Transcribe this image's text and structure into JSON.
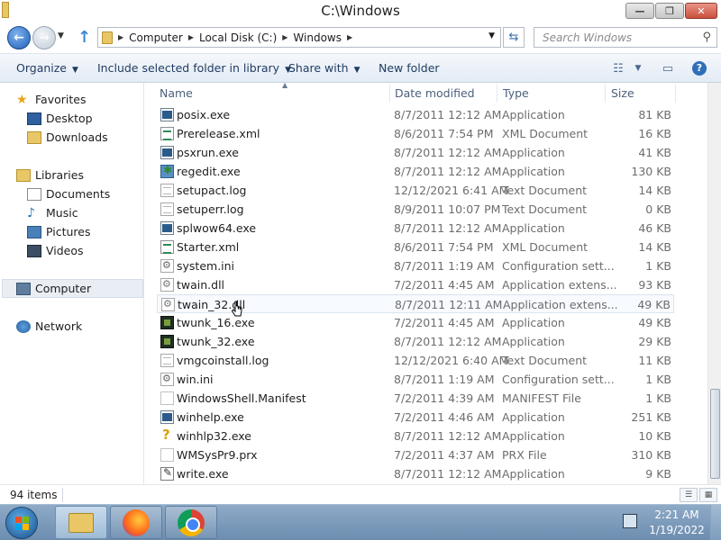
{
  "window": {
    "title": "C:\\Windows",
    "buttons": {
      "minimize": "—",
      "maximize": "❐",
      "close": "✕"
    }
  },
  "address": {
    "crumbs": [
      "Computer",
      "Local Disk (C:)",
      "Windows"
    ],
    "search_placeholder": "Search Windows"
  },
  "toolbar": {
    "organize": "Organize",
    "include": "Include selected folder in library",
    "share": "Share with",
    "new_folder": "New folder"
  },
  "nav": {
    "favorites": "Favorites",
    "desktop": "Desktop",
    "downloads": "Downloads",
    "libraries": "Libraries",
    "documents": "Documents",
    "music": "Music",
    "pictures": "Pictures",
    "videos": "Videos",
    "computer": "Computer",
    "network": "Network"
  },
  "columns": {
    "name": "Name",
    "date": "Date modified",
    "type": "Type",
    "size": "Size"
  },
  "files": [
    {
      "name": "posix.exe",
      "date": "8/7/2011 12:12 AM",
      "type": "Application",
      "size": "81 KB",
      "icon": "app"
    },
    {
      "name": "Prerelease.xml",
      "date": "8/6/2011 7:54 PM",
      "type": "XML Document",
      "size": "16 KB",
      "icon": "xml"
    },
    {
      "name": "psxrun.exe",
      "date": "8/7/2011 12:12 AM",
      "type": "Application",
      "size": "41 KB",
      "icon": "app"
    },
    {
      "name": "regedit.exe",
      "date": "8/7/2011 12:12 AM",
      "type": "Application",
      "size": "130 KB",
      "icon": "reg"
    },
    {
      "name": "setupact.log",
      "date": "12/12/2021 6:41 AM",
      "type": "Text Document",
      "size": "14 KB",
      "icon": "txt"
    },
    {
      "name": "setuperr.log",
      "date": "8/9/2011 10:07 PM",
      "type": "Text Document",
      "size": "0 KB",
      "icon": "txt"
    },
    {
      "name": "splwow64.exe",
      "date": "8/7/2011 12:12 AM",
      "type": "Application",
      "size": "46 KB",
      "icon": "app"
    },
    {
      "name": "Starter.xml",
      "date": "8/6/2011 7:54 PM",
      "type": "XML Document",
      "size": "14 KB",
      "icon": "xml"
    },
    {
      "name": "system.ini",
      "date": "8/7/2011 1:19 AM",
      "type": "Configuration sett...",
      "size": "1 KB",
      "icon": "cfg"
    },
    {
      "name": "twain.dll",
      "date": "7/2/2011 4:45 AM",
      "type": "Application extens...",
      "size": "93 KB",
      "icon": "dll"
    },
    {
      "name": "twain_32.dll",
      "date": "8/7/2011 12:11 AM",
      "type": "Application extens...",
      "size": "49 KB",
      "icon": "dll"
    },
    {
      "name": "twunk_16.exe",
      "date": "7/2/2011 4:45 AM",
      "type": "Application",
      "size": "49 KB",
      "icon": "twunk"
    },
    {
      "name": "twunk_32.exe",
      "date": "8/7/2011 12:12 AM",
      "type": "Application",
      "size": "29 KB",
      "icon": "twunk"
    },
    {
      "name": "vmgcoinstall.log",
      "date": "12/12/2021 6:40 AM",
      "type": "Text Document",
      "size": "11 KB",
      "icon": "txt"
    },
    {
      "name": "win.ini",
      "date": "8/7/2011 1:19 AM",
      "type": "Configuration sett...",
      "size": "1 KB",
      "icon": "cfg"
    },
    {
      "name": "WindowsShell.Manifest",
      "date": "7/2/2011 4:39 AM",
      "type": "MANIFEST File",
      "size": "1 KB",
      "icon": "blank"
    },
    {
      "name": "winhelp.exe",
      "date": "7/2/2011 4:46 AM",
      "type": "Application",
      "size": "251 KB",
      "icon": "app"
    },
    {
      "name": "winhlp32.exe",
      "date": "8/7/2011 12:12 AM",
      "type": "Application",
      "size": "10 KB",
      "icon": "help"
    },
    {
      "name": "WMSysPr9.prx",
      "date": "7/2/2011 4:37 AM",
      "type": "PRX File",
      "size": "310 KB",
      "icon": "blank"
    },
    {
      "name": "write.exe",
      "date": "8/7/2011 12:12 AM",
      "type": "Application",
      "size": "9 KB",
      "icon": "write"
    }
  ],
  "hover_index": 10,
  "status": {
    "items": "94 items"
  },
  "taskbar": {
    "time": "2:21 AM",
    "date": "1/19/2022"
  }
}
